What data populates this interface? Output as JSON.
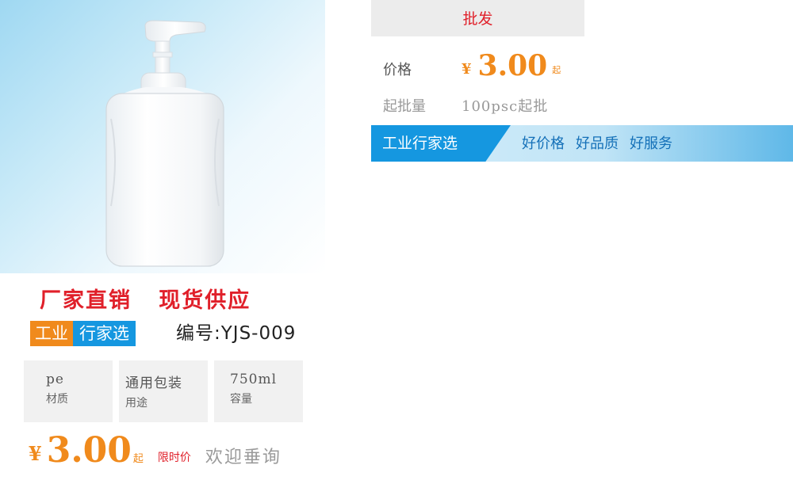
{
  "product": {
    "headline": "厂家直销   现货供应",
    "badge": {
      "part1": "工业",
      "part2": "行家选"
    },
    "model": "编号:YJS-009",
    "specs": [
      {
        "value": "pe",
        "label": "材质"
      },
      {
        "value": "通用包装",
        "label": "用途"
      },
      {
        "value": "750ml",
        "label": "容量"
      }
    ],
    "price": {
      "currency": "¥",
      "amount": "3.00",
      "unit": "起",
      "limited_label": "限时价",
      "inquiry_label": "欢迎垂询"
    }
  },
  "detail": {
    "tab_label": "批发",
    "price_label": "价格",
    "price": {
      "currency": "¥",
      "amount": "3.00",
      "unit": "起"
    },
    "moq_label": "起批量",
    "moq_value": "100psc起批",
    "slogan": {
      "tag": "工业行家选",
      "items": [
        "好价格",
        "好品质",
        "好服务"
      ]
    }
  },
  "colors": {
    "accent_red": "#e0202a",
    "accent_orange": "#f08a1c",
    "accent_blue": "#1597e0"
  }
}
